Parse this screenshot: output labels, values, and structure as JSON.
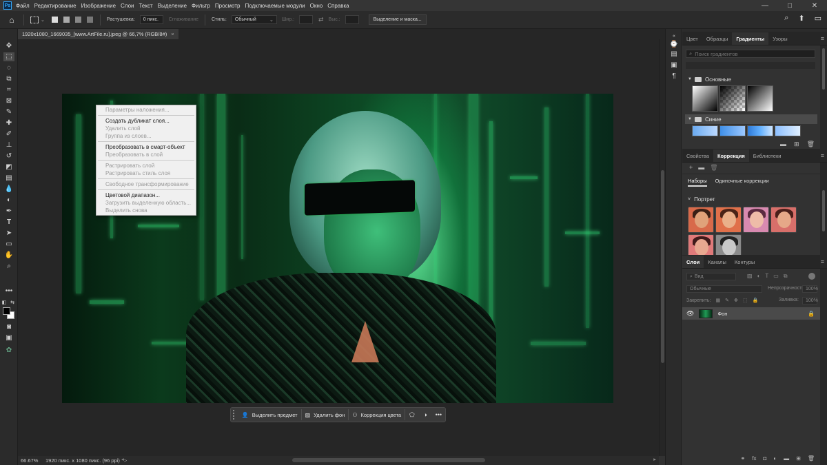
{
  "app": {
    "logo_text": "Ps"
  },
  "menubar": {
    "items": [
      "Файл",
      "Редактирование",
      "Изображение",
      "Слои",
      "Текст",
      "Выделение",
      "Фильтр",
      "Просмотр",
      "Подключаемые модули",
      "Окно",
      "Справка"
    ],
    "window_controls": [
      "—",
      "□",
      "✕"
    ]
  },
  "options_bar": {
    "feather_label": "Растушевка:",
    "feather_value": "0 пикс.",
    "antialias_label": "Сглаживание",
    "style_label": "Стиль:",
    "style_value": "Обычный",
    "width_label": "Шир.:",
    "height_label": "Выс.:",
    "select_mask_button": "Выделение и маска..."
  },
  "document": {
    "tab_title": "1920x1080_1669035_[www.ArtFile.ru].jpeg @ 66,7% (RGB/8#)",
    "close": "×"
  },
  "context_menu": {
    "items": [
      {
        "label": "Параметры наложения...",
        "enabled": false,
        "sep_after": true
      },
      {
        "label": "Создать дубликат слоя...",
        "enabled": true
      },
      {
        "label": "Удалить слой",
        "enabled": false
      },
      {
        "label": "Группа из слоев...",
        "enabled": false,
        "sep_after": true
      },
      {
        "label": "Преобразовать в смарт-объект",
        "enabled": true
      },
      {
        "label": "Преобразовать в слой",
        "enabled": false,
        "sep_after": true
      },
      {
        "label": "Растрировать слой",
        "enabled": false
      },
      {
        "label": "Растрировать стиль слоя",
        "enabled": false,
        "sep_after": true
      },
      {
        "label": "Свободное трансформирование",
        "enabled": false,
        "sep_after": true
      },
      {
        "label": "Цветовой диапазон...",
        "enabled": true
      },
      {
        "label": "Загрузить выделенную область...",
        "enabled": false
      },
      {
        "label": "Выделить снова",
        "enabled": false
      }
    ]
  },
  "taskbar": {
    "select_subject": "Выделить предмет",
    "remove_bg": "Удалить фон",
    "color_correction": "Коррекция цвета",
    "more": "•••"
  },
  "status": {
    "zoom": "66.67%",
    "doc_info": "1920 пикс. x 1080 пикс. (96 ppi)",
    "arrow": ">"
  },
  "gradients_panel": {
    "tabs": [
      "Цвет",
      "Образцы",
      "Градиенты",
      "Узоры"
    ],
    "active_tab": "Градиенты",
    "search_placeholder": "Поиск градиентов",
    "groups": [
      "Основные",
      "Синие"
    ]
  },
  "adjustments_panel": {
    "tabs": [
      "Свойства",
      "Коррекция",
      "Библиотеки"
    ],
    "active_tab": "Коррекция",
    "subtabs": [
      "Наборы",
      "Одиночные коррекции"
    ],
    "group": "Портрет"
  },
  "layers_panel": {
    "tabs": [
      "Слои",
      "Каналы",
      "Контуры"
    ],
    "active_tab": "Слои",
    "search_placeholder": "Вид",
    "blend_mode": "Обычные",
    "opacity_label": "Непрозрачность:",
    "opacity_value": "100%",
    "lock_label": "Закрепить:",
    "fill_label": "Заливка:",
    "fill_value": "100%",
    "layer_name": "Фон"
  }
}
